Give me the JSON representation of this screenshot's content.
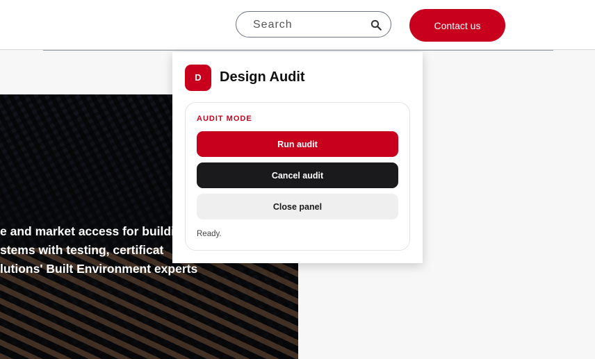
{
  "header": {
    "search": {
      "placeholder": "Search",
      "value": ""
    },
    "contact_label": "Contact us"
  },
  "hero": {
    "lines": [
      "e and market access for buildi",
      "stems with testing, certificat",
      "lutions' Built Environment experts"
    ]
  },
  "panel": {
    "badge": "D",
    "title": "Design Audit",
    "mode_label": "AUDIT MODE",
    "run_label": "Run audit",
    "cancel_label": "Cancel audit",
    "close_label": "Close panel",
    "status": "Ready."
  },
  "icons": {
    "search": "search-icon"
  },
  "colors": {
    "accent": "#c8001e",
    "dark": "#1a1a1c",
    "light": "#efefef"
  }
}
